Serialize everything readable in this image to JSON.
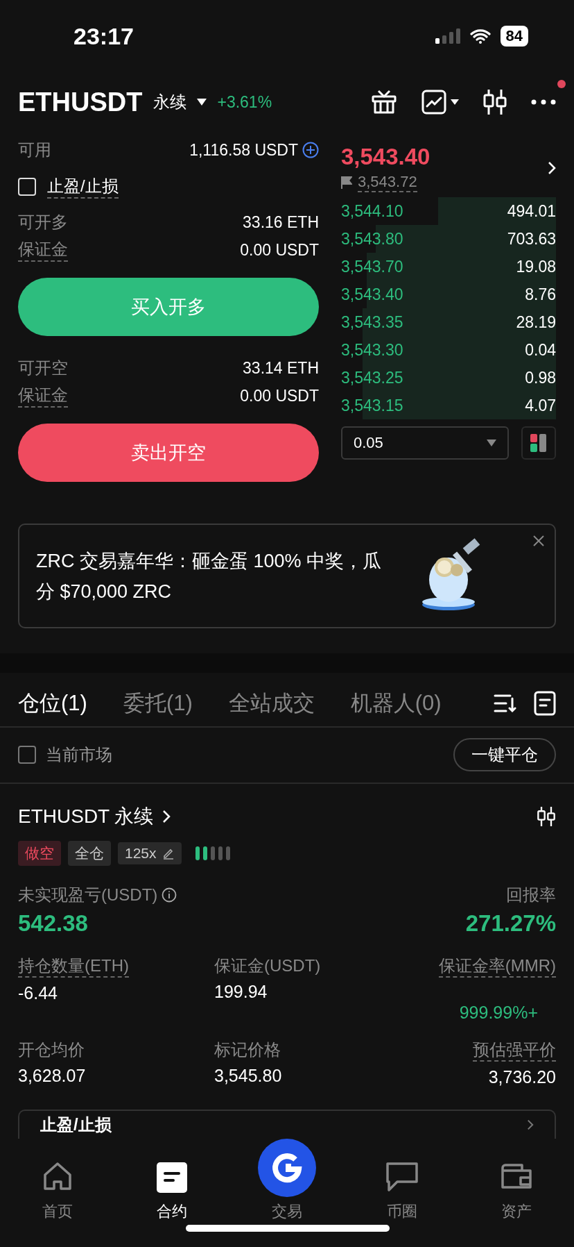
{
  "status_bar": {
    "time": "23:17",
    "battery": "84"
  },
  "header": {
    "symbol": "ETHUSDT",
    "contract": "永续",
    "change": "+3.61%",
    "notification": true
  },
  "order_form": {
    "available_label": "可用",
    "available_value": "1,116.58 USDT",
    "tpsl": {
      "label": "止盈/止损",
      "checked": false
    },
    "long": {
      "max_label": "可开多",
      "max_value": "33.16 ETH",
      "margin_label": "保证金",
      "margin_value": "0.00 USDT",
      "button": "买入开多"
    },
    "short": {
      "max_label": "可开空",
      "max_value": "33.14 ETH",
      "margin_label": "保证金",
      "margin_value": "0.00 USDT",
      "button": "卖出开空"
    }
  },
  "order_book": {
    "last_price": "3,543.40",
    "mark_price": "3,543.72",
    "rows": [
      {
        "price": "3,544.10",
        "amount": "494.01"
      },
      {
        "price": "3,543.80",
        "amount": "703.63"
      },
      {
        "price": "3,543.70",
        "amount": "19.08"
      },
      {
        "price": "3,543.40",
        "amount": "8.76"
      },
      {
        "price": "3,543.35",
        "amount": "28.19"
      },
      {
        "price": "3,543.30",
        "amount": "0.04"
      },
      {
        "price": "3,543.25",
        "amount": "0.98"
      },
      {
        "price": "3,543.15",
        "amount": "4.07"
      }
    ],
    "precision": "0.05"
  },
  "banner": {
    "text": "ZRC 交易嘉年华：砸金蛋 100% 中奖，瓜分 $70,000 ZRC"
  },
  "tabs": [
    {
      "label": "仓位(1)",
      "selected": true
    },
    {
      "label": "委托(1)",
      "selected": false
    },
    {
      "label": "全站成交",
      "selected": false
    },
    {
      "label": "机器人(0)",
      "selected": false
    }
  ],
  "filter": {
    "label": "当前市场",
    "checked": false,
    "close_all": "一键平仓"
  },
  "position": {
    "title": "ETHUSDT 永续",
    "side": "做空",
    "margin_mode": "全仓",
    "leverage": "125x",
    "risk": {
      "level": 0.4
    },
    "pnl_label": "未实现盈亏(USDT)",
    "pnl_value": "542.38",
    "roe_label": "回报率",
    "roe_value": "271.27%",
    "fields": [
      {
        "label": "持仓数量(ETH)",
        "value": "-6.44",
        "kind": "plain"
      },
      {
        "label": "保证金(USDT)",
        "value": "199.94",
        "kind": "plain"
      },
      {
        "label": "保证金率(MMR)",
        "value": "999.99%+",
        "kind": "positive"
      },
      {
        "label": "开仓均价",
        "value": "3,628.07",
        "kind": "plain"
      },
      {
        "label": "标记价格",
        "value": "3,545.80",
        "kind": "plain"
      },
      {
        "label": "预估强平价",
        "value": "3,736.20",
        "kind": "plain"
      }
    ],
    "tpsl_label": "止盈/止损"
  },
  "nav": [
    {
      "label": "首页",
      "selected": false,
      "kind": "home"
    },
    {
      "label": "合约",
      "selected": true,
      "kind": "contract"
    },
    {
      "label": "交易",
      "selected": false,
      "kind": "trade"
    },
    {
      "label": "币圈",
      "selected": false,
      "kind": "chat"
    },
    {
      "label": "资产",
      "selected": false,
      "kind": "wallet"
    }
  ]
}
